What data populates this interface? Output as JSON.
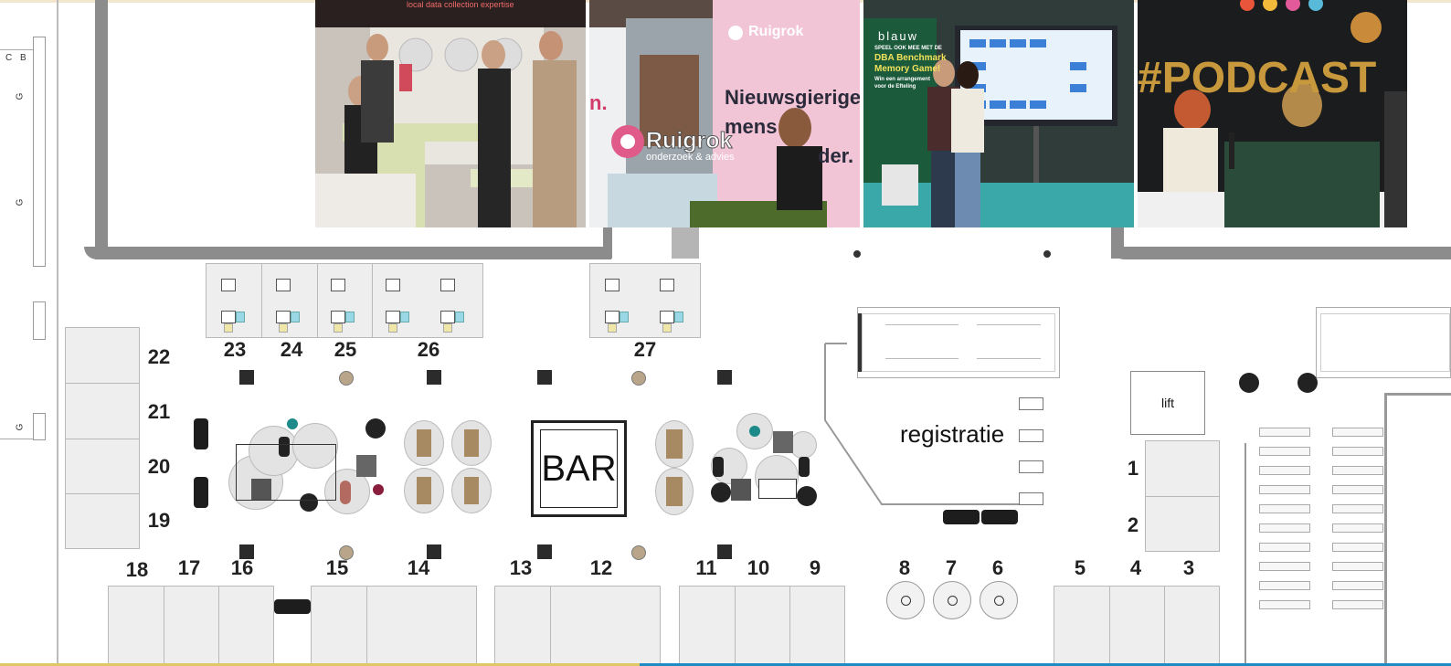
{
  "photos": {
    "photo1": {
      "caption": "local data collection expertise"
    },
    "photo2": {
      "brand": "Ruigrok",
      "sub": "onderzoek & advies",
      "wall_text_1": "Nieuwsgierige",
      "wall_text_2": "mens",
      "wall_text_3": "der.",
      "left_text": "n."
    },
    "photo3": {
      "brand": "blauw",
      "game_1": "SPEEL OOK MEE MET DE",
      "game_2": "DBA Benchmark",
      "game_3": "Memory Game!",
      "game_4": "Win een arrangement",
      "game_5": "voor de Efteling"
    },
    "photo4": {
      "hashtag": "#PODCAST"
    }
  },
  "plan": {
    "bar_label": "BAR",
    "lift_label": "lift",
    "registration_label": "registratie",
    "side_letters": [
      "C",
      "B",
      "G",
      "G",
      "G"
    ],
    "booth_numbers_top": [
      "23",
      "24",
      "25",
      "26",
      "27"
    ],
    "booth_numbers_left": [
      "22",
      "21",
      "20",
      "19"
    ],
    "booth_numbers_bottom": [
      "18",
      "17",
      "16",
      "15",
      "14",
      "13",
      "12",
      "11",
      "10",
      "9"
    ],
    "table_numbers": [
      "8",
      "7",
      "6"
    ],
    "booth_numbers_right_bottom": [
      "5",
      "4",
      "3"
    ],
    "booth_numbers_right": [
      "1",
      "2"
    ]
  }
}
